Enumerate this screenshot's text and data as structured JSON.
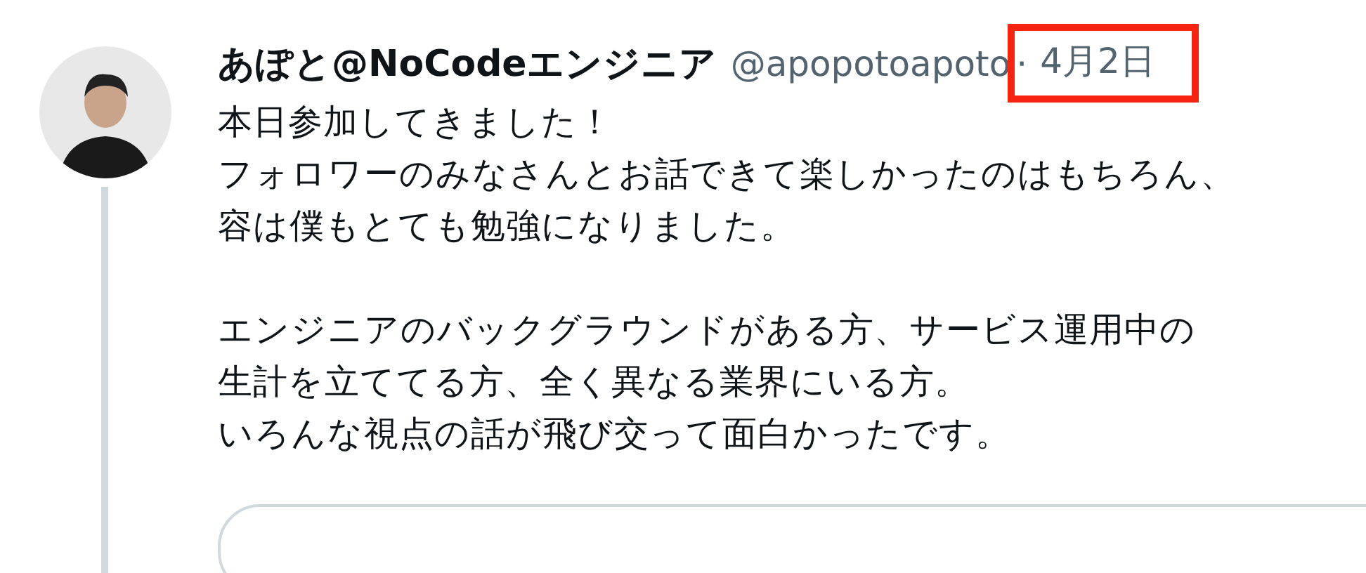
{
  "tweet": {
    "author_name": "あぽと@NoCodeエンジニア",
    "handle": "@apopotoapoto",
    "separator": "·",
    "date": {
      "text": "4月2日",
      "highlighted": true
    },
    "paragraphs": [
      [
        "本日参加してきました！",
        "フォロワーのみなさんとお話できて楽しかったのはもちろん、",
        "容は僕もとても勉強になりました。"
      ],
      [
        "エンジニアのバックグラウンドがある方、サービス運用中の",
        "生計を立ててる方、全く異なる業界にいる方。",
        "いろんな視点の話が飛び交って面白かったです。"
      ]
    ]
  }
}
